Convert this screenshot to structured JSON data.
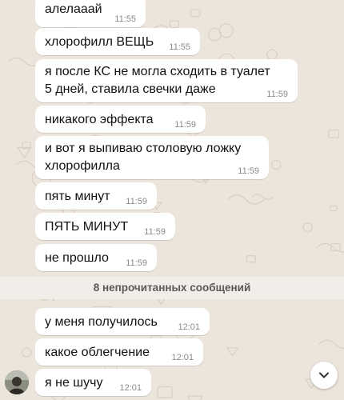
{
  "chat": {
    "messages": [
      {
        "text": "алелааай",
        "time": "11:55"
      },
      {
        "text": "хлорофилл ВЕЩЬ",
        "time": "11:55"
      },
      {
        "text": "я после КС не могла сходить в туалет\n5 дней, ставила свечки даже",
        "time": "11:59"
      },
      {
        "text": "никакого эффекта",
        "time": "11:59"
      },
      {
        "text": "и вот я выпиваю столовую ложку\nхлорофилла",
        "time": "11:59"
      },
      {
        "text": "пять минут",
        "time": "11:59"
      },
      {
        "text": "ПЯТЬ МИНУТ",
        "time": "11:59"
      },
      {
        "text": "не прошло",
        "time": "11:59"
      }
    ],
    "unread_banner": "8 непрочитанных сообщений",
    "unread_messages": [
      {
        "text": "у меня получилось",
        "time": "12:01"
      },
      {
        "text": "какое облегчение",
        "time": "12:01"
      },
      {
        "text": "я не шучу",
        "time": "12:01"
      }
    ]
  },
  "icons": {
    "avatar": "avatar",
    "scroll_down": "chevron-down-icon"
  },
  "colors": {
    "background": "#ece5dc",
    "bubble": "#ffffff",
    "time": "#8a8a8a",
    "banner": "#f1ede8"
  }
}
